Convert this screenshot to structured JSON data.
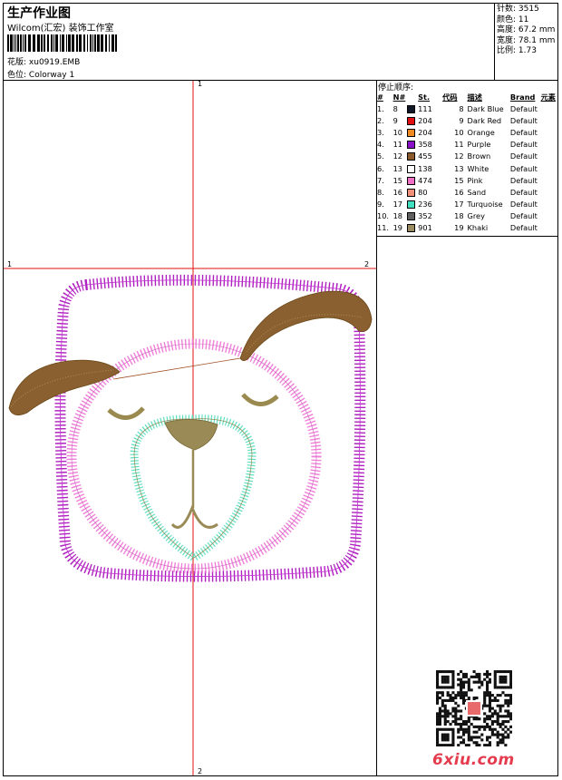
{
  "header": {
    "title": "生产作业图",
    "subtitle": "Wilcom(汇宏) 装饰工作室",
    "design_label": "花版:",
    "design_value": "xu0919.EMB",
    "colorway_label": "色位:",
    "colorway_value": "Colorway 1"
  },
  "stats": {
    "stitches_label": "针数:",
    "stitches_value": "3515",
    "colors_label": "颜色:",
    "colors_value": "11",
    "height_label": "高度:",
    "height_value": "67.2 mm",
    "width_label": "宽度:",
    "width_value": "78.1 mm",
    "scale_label": "比例:",
    "scale_value": "1.73"
  },
  "stop_sequence": {
    "title": "停止顺序:",
    "headers": {
      "idx": "#",
      "n": "N#",
      "st": "St.",
      "code": "代码",
      "desc": "描述",
      "brand": "Brand",
      "element": "元素"
    },
    "rows": [
      {
        "idx": "1.",
        "n": "8",
        "color": "#101828",
        "st": "111",
        "code": "8",
        "desc": "Dark Blue",
        "brand": "Default"
      },
      {
        "idx": "2.",
        "n": "9",
        "color": "#e01010",
        "st": "204",
        "code": "9",
        "desc": "Dark Red",
        "brand": "Default"
      },
      {
        "idx": "3.",
        "n": "10",
        "color": "#f08a20",
        "st": "204",
        "code": "10",
        "desc": "Orange",
        "brand": "Default"
      },
      {
        "idx": "4.",
        "n": "11",
        "color": "#8a10c8",
        "st": "358",
        "code": "11",
        "desc": "Purple",
        "brand": "Default"
      },
      {
        "idx": "5.",
        "n": "12",
        "color": "#8a5a2a",
        "st": "455",
        "code": "12",
        "desc": "Brown",
        "brand": "Default"
      },
      {
        "idx": "6.",
        "n": "13",
        "color": "#ffffff",
        "st": "138",
        "code": "13",
        "desc": "White",
        "brand": "Default"
      },
      {
        "idx": "7.",
        "n": "15",
        "color": "#f070c8",
        "st": "474",
        "code": "15",
        "desc": "Pink",
        "brand": "Default"
      },
      {
        "idx": "8.",
        "n": "16",
        "color": "#f0907a",
        "st": "80",
        "code": "16",
        "desc": "Sand",
        "brand": "Default"
      },
      {
        "idx": "9.",
        "n": "17",
        "color": "#40e0c0",
        "st": "236",
        "code": "17",
        "desc": "Turquoise",
        "brand": "Default"
      },
      {
        "idx": "10.",
        "n": "18",
        "color": "#606060",
        "st": "352",
        "code": "18",
        "desc": "Grey",
        "brand": "Default"
      },
      {
        "idx": "11.",
        "n": "19",
        "color": "#9a8a60",
        "st": "901",
        "code": "19",
        "desc": "Khaki",
        "brand": "Default"
      }
    ]
  },
  "axis_labels": {
    "top": "1",
    "bottom": "2",
    "left": "1",
    "right": "2"
  },
  "watermark": "6xiu.com",
  "stamp_text": "6xiu"
}
